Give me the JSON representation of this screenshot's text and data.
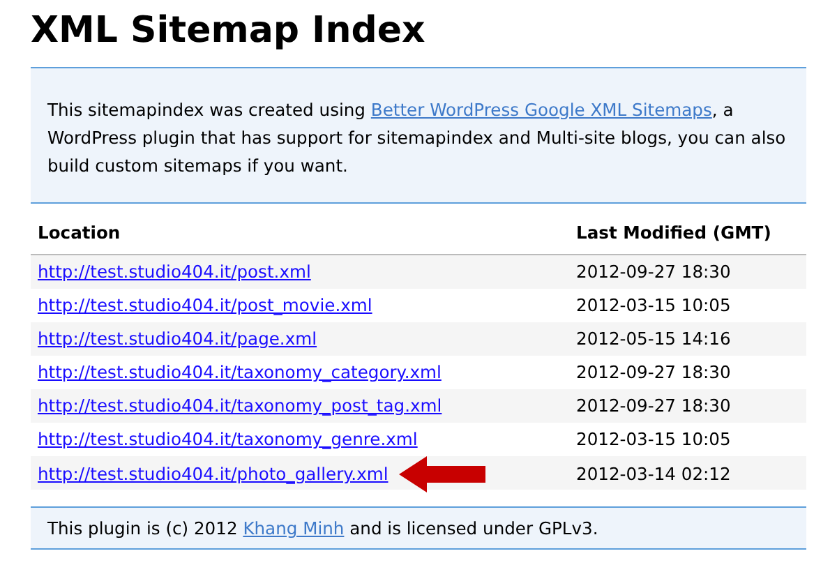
{
  "title": "XML Sitemap Index",
  "intro": {
    "before": "This sitemapindex was created using ",
    "link": "Better WordPress Google XML Sitemaps",
    "after": ", a WordPress plugin that has support for sitemapindex and Multi-site blogs, you can also build custom sitemaps if you want."
  },
  "table": {
    "columns": [
      "Location",
      "Last Modified (GMT)"
    ],
    "rows": [
      {
        "location": "http://test.studio404.it/post.xml",
        "modified": "2012-09-27 18:30",
        "marked": false
      },
      {
        "location": "http://test.studio404.it/post_movie.xml",
        "modified": "2012-03-15 10:05",
        "marked": false
      },
      {
        "location": "http://test.studio404.it/page.xml",
        "modified": "2012-05-15 14:16",
        "marked": false
      },
      {
        "location": "http://test.studio404.it/taxonomy_category.xml",
        "modified": "2012-09-27 18:30",
        "marked": false
      },
      {
        "location": "http://test.studio404.it/taxonomy_post_tag.xml",
        "modified": "2012-09-27 18:30",
        "marked": false
      },
      {
        "location": "http://test.studio404.it/taxonomy_genre.xml",
        "modified": "2012-03-15 10:05",
        "marked": false
      },
      {
        "location": "http://test.studio404.it/photo_gallery.xml",
        "modified": "2012-03-14 02:12",
        "marked": true
      }
    ]
  },
  "footer": {
    "before": "This plugin is (c) 2012 ",
    "link": "Khang Minh",
    "after": " and is licensed under GPLv3."
  }
}
